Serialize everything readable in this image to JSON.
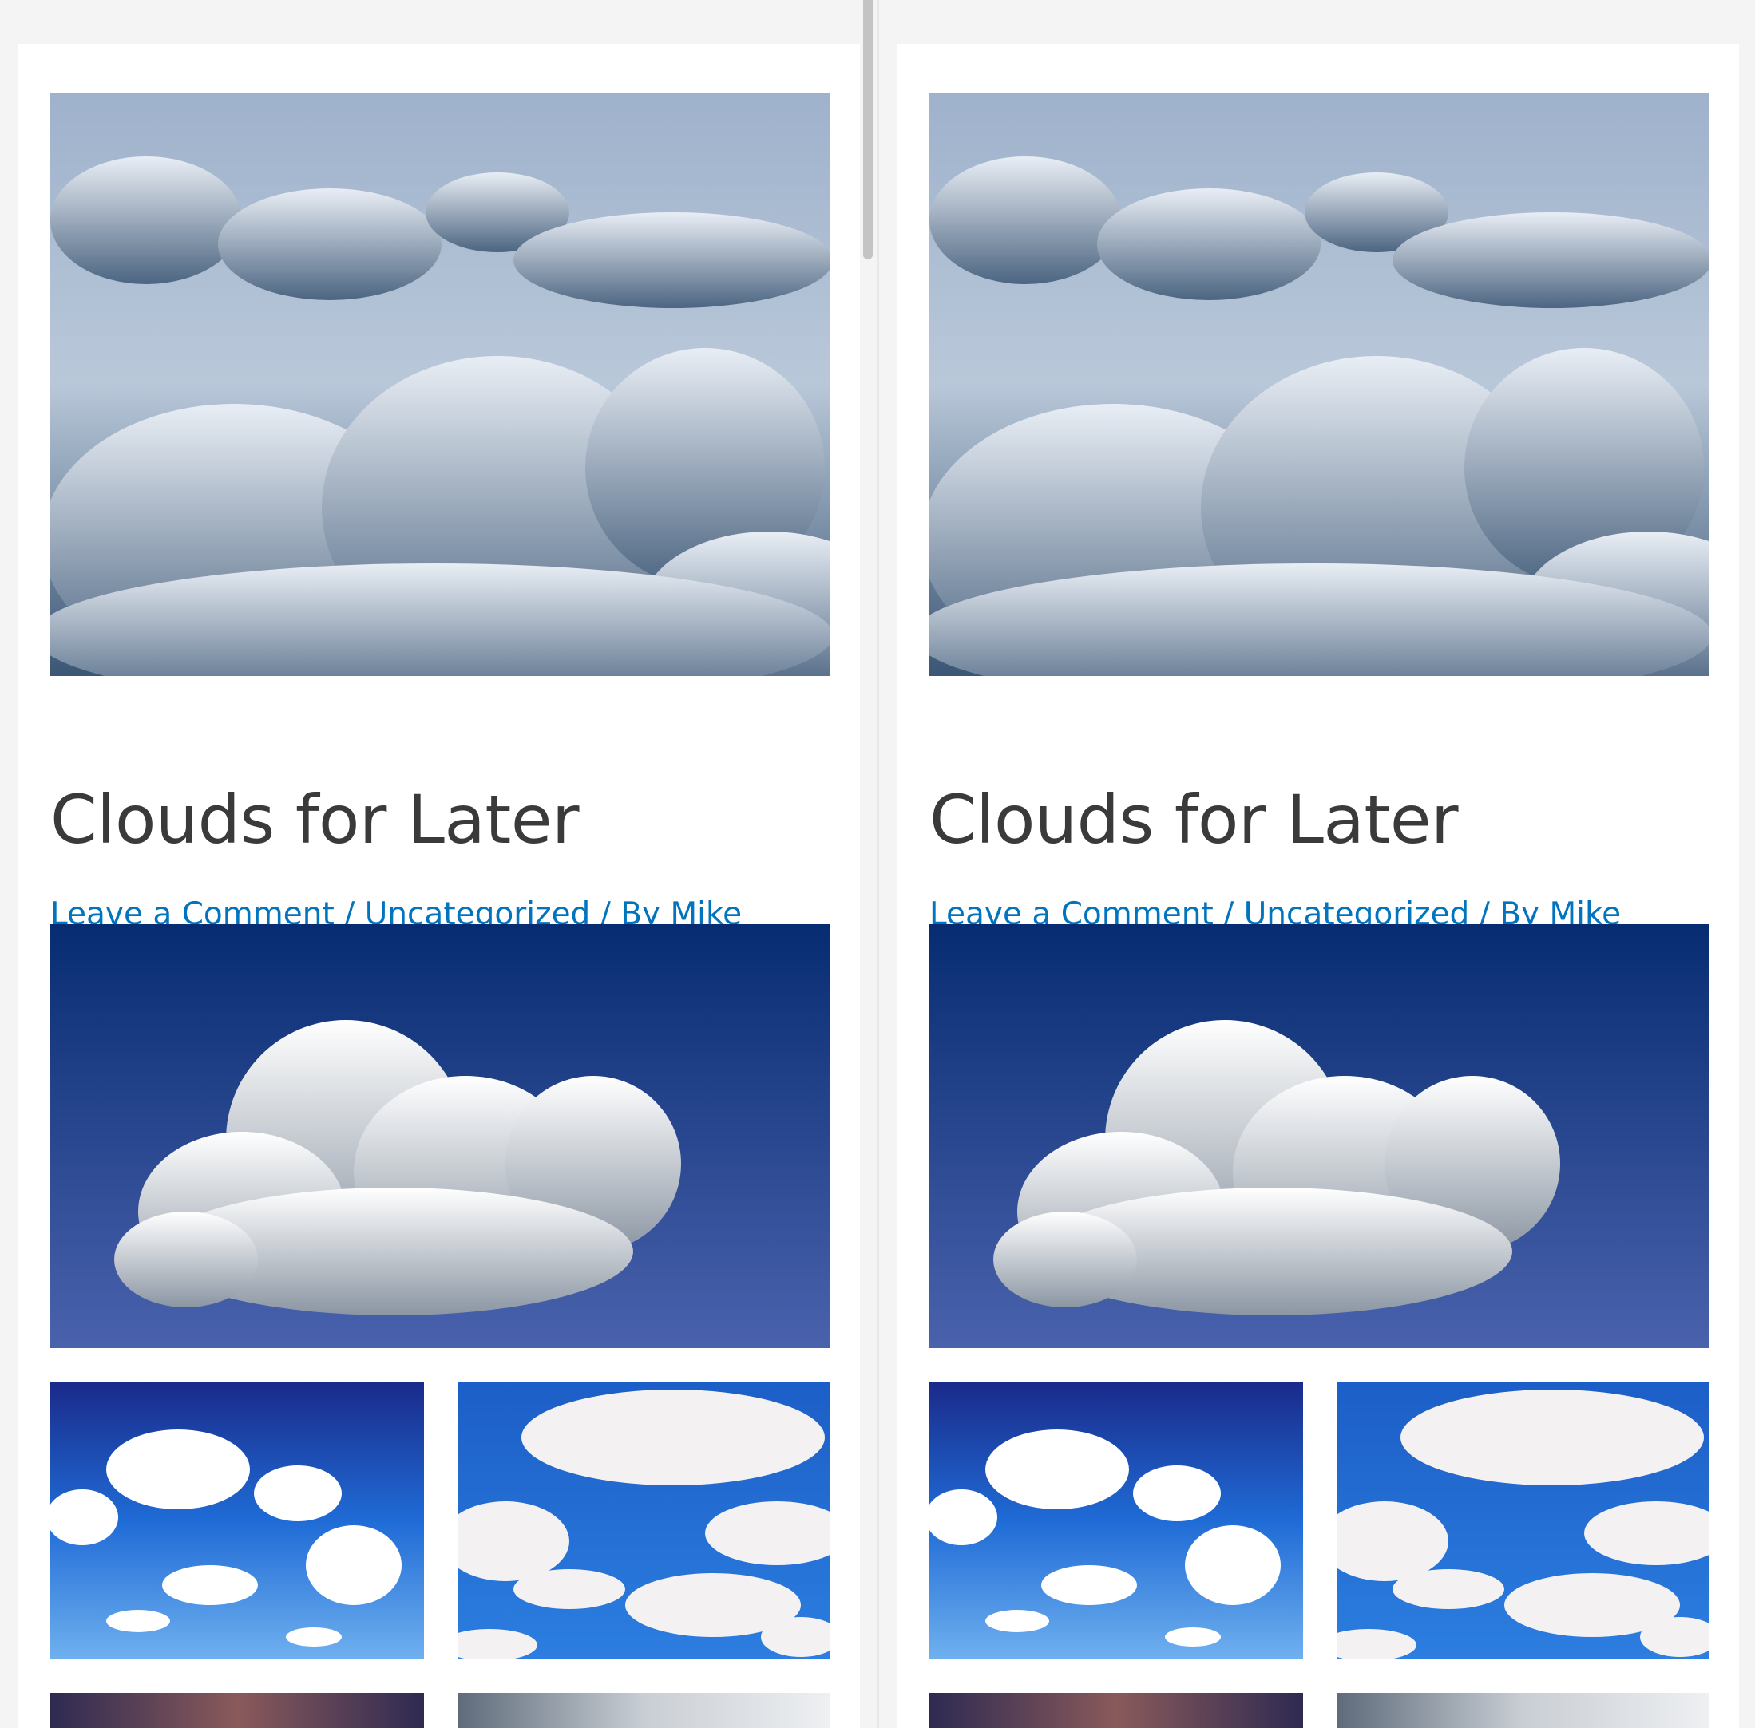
{
  "posts": [
    {
      "title": "Clouds for Later",
      "meta": {
        "comment_link": "Leave a Comment",
        "separator": " / ",
        "category": "Uncategorized",
        "author_prefix": "By ",
        "author": "Mike"
      }
    },
    {
      "title": "Clouds for Later",
      "meta": {
        "comment_link": "Leave a Comment",
        "separator": " / ",
        "category": "Uncategorized",
        "author_prefix": "By ",
        "author": "Mike"
      }
    }
  ],
  "colors": {
    "link": "#0274be",
    "title": "#3a3a3a",
    "background": "#f4f4f4",
    "card": "#ffffff"
  }
}
